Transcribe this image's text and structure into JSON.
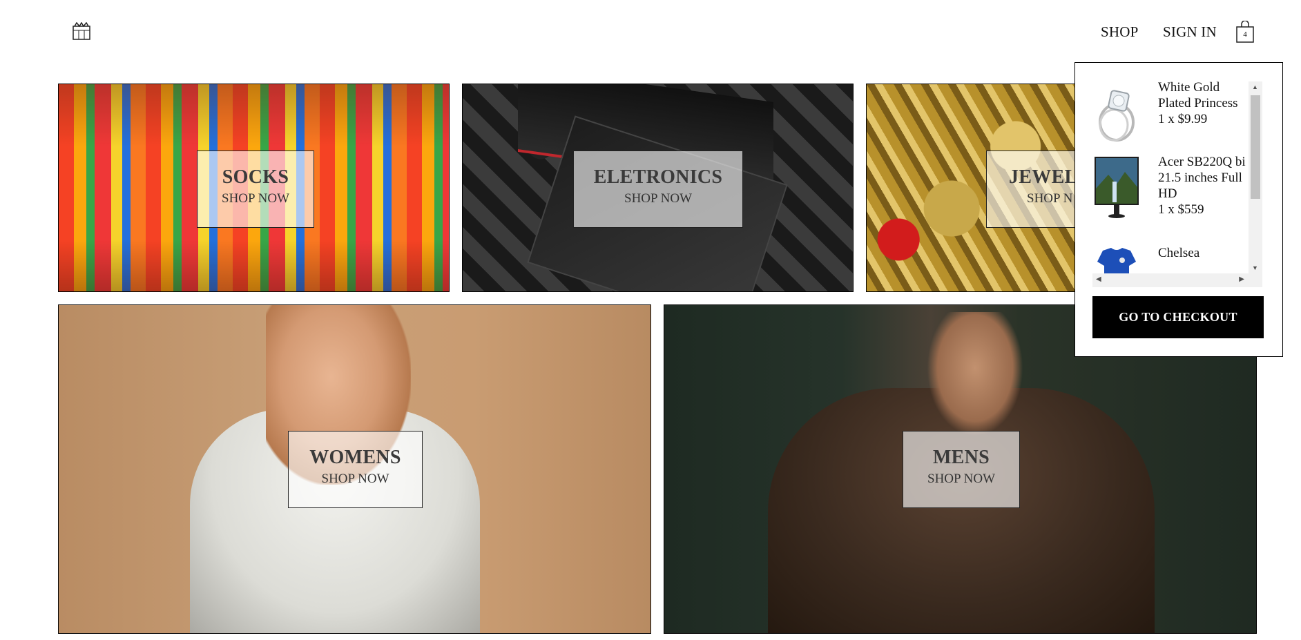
{
  "header": {
    "logo_icon": "crown-logo-icon",
    "nav": {
      "shop": "SHOP",
      "sign_in": "SIGN IN"
    },
    "bag_icon": "shopping-bag-icon",
    "cart_count": "4"
  },
  "categories": [
    {
      "title": "SOCKS",
      "cta": "SHOP NOW"
    },
    {
      "title": "ELETRONICS",
      "cta": "SHOP NOW"
    },
    {
      "title": "JEWEL",
      "cta": "SHOP N"
    },
    {
      "title": "WOMENS",
      "cta": "SHOP NOW"
    },
    {
      "title": "MENS",
      "cta": "SHOP NOW"
    }
  ],
  "cart": {
    "items": [
      {
        "name": "White Gold Plated Princess",
        "qty_price": "1 x $9.99"
      },
      {
        "name": "Acer SB220Q bi 21.5 inches Full HD",
        "qty_price": "1 x $559"
      },
      {
        "name": "Chelsea",
        "qty_price": ""
      }
    ],
    "checkout_label": "GO TO CHECKOUT"
  }
}
